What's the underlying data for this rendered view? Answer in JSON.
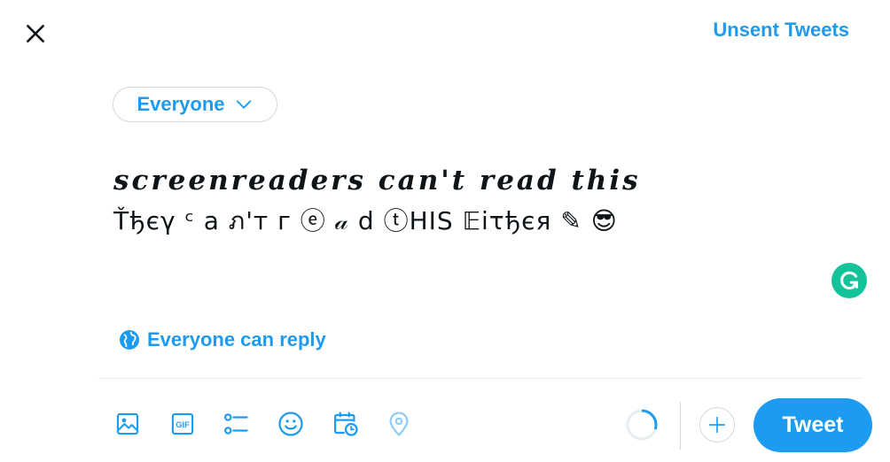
{
  "header": {
    "unsent_label": "Unsent Tweets"
  },
  "audience": {
    "label": "Everyone"
  },
  "composer": {
    "line1": "𝒔𝒄𝒓𝒆𝒆𝒏𝒓𝒆𝒂𝒅𝒆𝒓𝒔 𝒄𝒂𝒏'𝒕 𝒓𝒆𝒂𝒅 𝒕𝒉𝒊𝒔",
    "line2": "Ťђєγ ᶜ a ภ'т г ⓔ 𝒶 d ⓣHIS 𝔼iτђєя ✎ 😎"
  },
  "reply_setting": {
    "label": "Everyone can reply"
  },
  "toolbar": {
    "icons": [
      "image-icon",
      "gif-icon",
      "poll-icon",
      "emoji-icon",
      "schedule-icon",
      "location-icon"
    ],
    "tweet_label": "Tweet",
    "char_progress": 0.3
  },
  "colors": {
    "accent": "#1d9bf0",
    "grammarly": "#15c39a",
    "border": "#cfd9de"
  }
}
